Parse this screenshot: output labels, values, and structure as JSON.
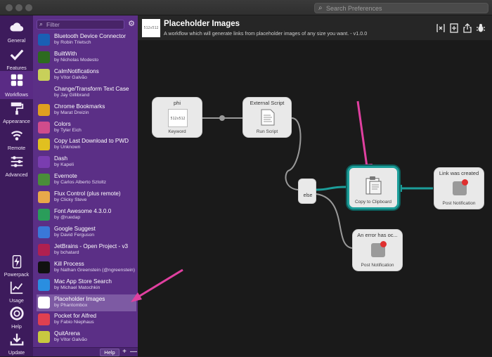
{
  "search_preferences": {
    "placeholder": "Search Preferences"
  },
  "nav": [
    {
      "label": "General",
      "icon": "cloud-icon"
    },
    {
      "label": "Features",
      "icon": "checkmark-icon"
    },
    {
      "label": "Workflows",
      "icon": "grid-icon",
      "active": true
    },
    {
      "label": "Appearance",
      "icon": "paint-roller-icon"
    },
    {
      "label": "Remote",
      "icon": "wifi-icon"
    },
    {
      "label": "Advanced",
      "icon": "sliders-icon"
    },
    {
      "label": "Powerpack",
      "icon": "lightning-icon"
    },
    {
      "label": "Usage",
      "icon": "chart-icon"
    },
    {
      "label": "Help",
      "icon": "lifebuoy-icon"
    },
    {
      "label": "Update",
      "icon": "download-icon"
    }
  ],
  "filter": {
    "placeholder": "Filter"
  },
  "workflows": [
    {
      "name": "Bluetooth Device Connector",
      "author": "by Robin Trietsch",
      "color": "#1a5fb4"
    },
    {
      "name": "BuiltWith",
      "author": "by Nicholas Modesto",
      "color": "#2d6a1f"
    },
    {
      "name": "CalmNotifications",
      "author": "by Vítor Galvão",
      "color": "#c8d05a"
    },
    {
      "name": "Change/Transform Text Case",
      "author": "by Jay Gillibrand",
      "color": "#5b2f86"
    },
    {
      "name": "Chrome Bookmarks",
      "author": "by Marat Dreizin",
      "color": "#e0a020"
    },
    {
      "name": "Colors",
      "author": "by Tyler Eich",
      "color": "#d04c8c"
    },
    {
      "name": "Copy Last Download to PWD",
      "author": "by Unknown",
      "color": "#e0c020"
    },
    {
      "name": "Dash",
      "author": "by Kapeli",
      "color": "#7a3db0"
    },
    {
      "name": "Evernote",
      "author": "by Carlos Alberto Sztoltz",
      "color": "#4a8d3a"
    },
    {
      "name": "Flux Control (plus remote)",
      "author": "by Clicky Steve",
      "color": "#e8a84a"
    },
    {
      "name": "Font Awesome 4.3.0.0",
      "author": "by @ruedap",
      "color": "#2a9d5a"
    },
    {
      "name": "Google Suggest",
      "author": "by David Ferguson",
      "color": "#3a78d8"
    },
    {
      "name": "JetBrains - Open Project - v3",
      "author": "by bchatard",
      "color": "#b02050"
    },
    {
      "name": "Kill Process",
      "author": "by Nathan Greenstein (@ngreenstein)",
      "color": "#111111"
    },
    {
      "name": "Mac App Store Search",
      "author": "by Michael Matochkin",
      "color": "#2a8ee0"
    },
    {
      "name": "Placeholder Images",
      "author": "by Phantombox",
      "color": "#ffffff",
      "selected": true
    },
    {
      "name": "Pocket for Alfred",
      "author": "by Fabio Niephaus",
      "color": "#e04050"
    },
    {
      "name": "QuitArena",
      "author": "by Vítor Galvão",
      "color": "#c8c840"
    }
  ],
  "list_footer": {
    "help": "Help",
    "add": "+",
    "remove": "—"
  },
  "workflow": {
    "thumb_text": "512x512",
    "title": "Placeholder Images",
    "description": "A workflow which will generate links from placeholder images of any size you want. - v1.0.0"
  },
  "header_buttons": [
    "variables-icon",
    "add-object-icon",
    "share-icon",
    "debug-bug-icon"
  ],
  "nodes": {
    "keyword": {
      "title": "phi",
      "thumb": "512x512",
      "sub": "Keyword"
    },
    "script": {
      "title": "External Script",
      "sub": "Run Script"
    },
    "else": {
      "title": "else"
    },
    "copy": {
      "sub": "Copy to Clipboard"
    },
    "notify_ok": {
      "title": "Link was created",
      "sub": "Post Notification"
    },
    "notify_err": {
      "title": "An error has oc...",
      "sub": "Post Notification"
    }
  },
  "colors": {
    "accent_arrow": "#e040a0",
    "connector": "#1c9e9a",
    "sidebar": "#5b2f86"
  }
}
